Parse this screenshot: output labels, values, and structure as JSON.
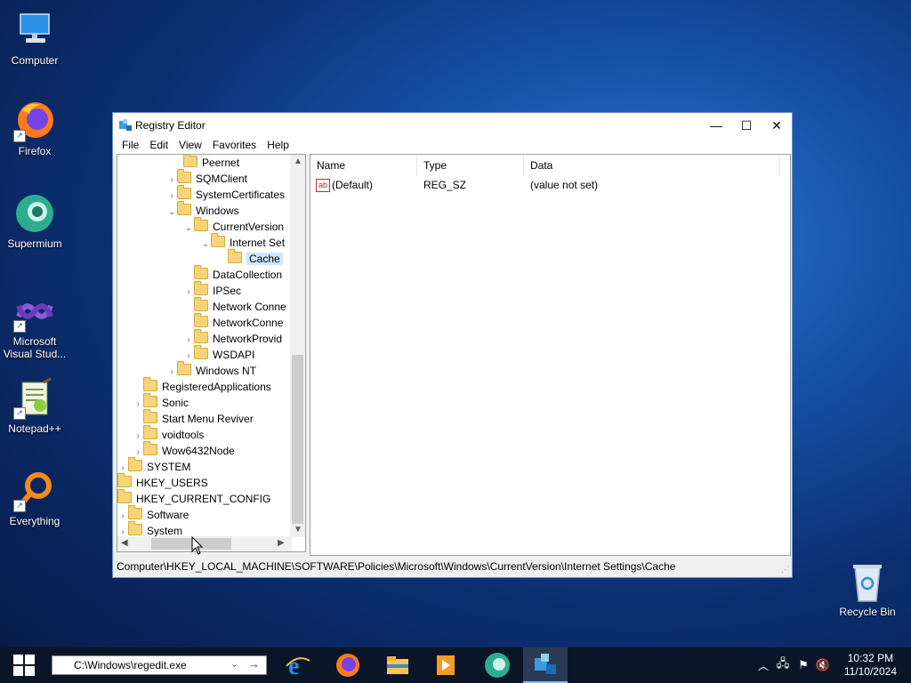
{
  "desktop": {
    "icons": [
      {
        "label": "Computer"
      },
      {
        "label": "Firefox"
      },
      {
        "label": "Supermium"
      },
      {
        "label": "Microsoft Visual Stud..."
      },
      {
        "label": "Notepad++"
      },
      {
        "label": "Everything"
      }
    ],
    "recycle_bin": "Recycle Bin"
  },
  "window": {
    "title": "Registry Editor",
    "menu": [
      "File",
      "Edit",
      "View",
      "Favorites",
      "Help"
    ],
    "tree": [
      {
        "label": "Peernet"
      },
      {
        "label": "SQMClient"
      },
      {
        "label": "SystemCertificates"
      },
      {
        "label": "Windows"
      },
      {
        "label": "CurrentVersion"
      },
      {
        "label": "Internet Set"
      },
      {
        "label": "Cache"
      },
      {
        "label": "DataCollection"
      },
      {
        "label": "IPSec"
      },
      {
        "label": "Network Conne"
      },
      {
        "label": "NetworkConne"
      },
      {
        "label": "NetworkProvid"
      },
      {
        "label": "WSDAPI"
      },
      {
        "label": "Windows NT"
      },
      {
        "label": "RegisteredApplications"
      },
      {
        "label": "Sonic"
      },
      {
        "label": "Start Menu Reviver"
      },
      {
        "label": "voidtools"
      },
      {
        "label": "Wow6432Node"
      },
      {
        "label": "SYSTEM"
      },
      {
        "label": "HKEY_USERS"
      },
      {
        "label": "HKEY_CURRENT_CONFIG"
      },
      {
        "label": "Software"
      },
      {
        "label": "System"
      }
    ],
    "columns": [
      "Name",
      "Type",
      "Data"
    ],
    "values": [
      {
        "name": "(Default)",
        "type": "REG_SZ",
        "data": "(value not set)"
      }
    ],
    "status": "Computer\\HKEY_LOCAL_MACHINE\\SOFTWARE\\Policies\\Microsoft\\Windows\\CurrentVersion\\Internet Settings\\Cache"
  },
  "taskbar": {
    "run_value": "C:\\Windows\\regedit.exe",
    "time": "10:32 PM",
    "date": "11/10/2024"
  }
}
